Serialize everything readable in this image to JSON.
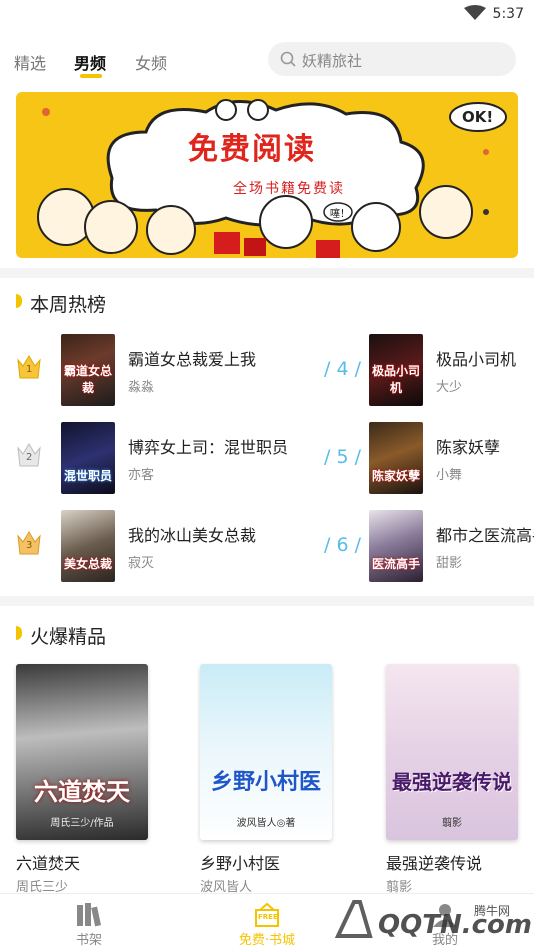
{
  "status": {
    "time": "5:37"
  },
  "nav": {
    "tabs": [
      "精选",
      "男频",
      "女频"
    ],
    "active_tab": 1,
    "search_placeholder": "妖精旅社"
  },
  "banner": {
    "title": "免费阅读",
    "subtitle": "全场书籍免费读",
    "ok_text": "OK!",
    "sticker_text": "噻！"
  },
  "weekly": {
    "title": "本周热榜",
    "items": [
      {
        "rank": "1",
        "title": "霸道女总裁爱上我",
        "author": "淼淼",
        "cover_text": "霸道女总裁"
      },
      {
        "rank": "2",
        "title": "博弈女上司：混世职员",
        "author": "亦客",
        "cover_text": "混世职员"
      },
      {
        "rank": "3",
        "title": "我的冰山美女总裁",
        "author": "寂灭",
        "cover_text": "美女总裁"
      },
      {
        "rank": "/ 4 /",
        "title": "极品小司机",
        "author": "大少",
        "cover_text": "极品小司机"
      },
      {
        "rank": "/ 5 /",
        "title": "陈家妖孽",
        "author": "小舞",
        "cover_text": "陈家妖孽"
      },
      {
        "rank": "/ 6 /",
        "title": "都市之医流高手",
        "author": "甜影",
        "cover_text": "医流高手"
      }
    ]
  },
  "hot": {
    "title": "火爆精品",
    "items": [
      {
        "title": "六道焚天",
        "author": "周氏三少",
        "cover_text": "六道焚天",
        "cover_sub": "周氏三少/作品"
      },
      {
        "title": "乡野小村医",
        "author": "波风皆人",
        "cover_text": "乡野小村医",
        "cover_sub": "波风皆人◎著"
      },
      {
        "title": "最强逆袭传说",
        "author": "翦影",
        "cover_text": "最强逆袭传说",
        "cover_sub": "翦影"
      }
    ]
  },
  "bottom_tabs": [
    {
      "label": "书架",
      "icon": "books-icon"
    },
    {
      "label": "免费·书城",
      "icon": "free-store-icon",
      "badge": "FREE"
    },
    {
      "label": "我的",
      "icon": "profile-icon"
    }
  ],
  "watermark": {
    "text": "QQTN.com",
    "brand": "腾牛网"
  },
  "colors": {
    "accent": "#f5c400",
    "rank_number": "#57bde8",
    "banner_bg": "#f6c516",
    "banner_title": "#e0261c"
  }
}
